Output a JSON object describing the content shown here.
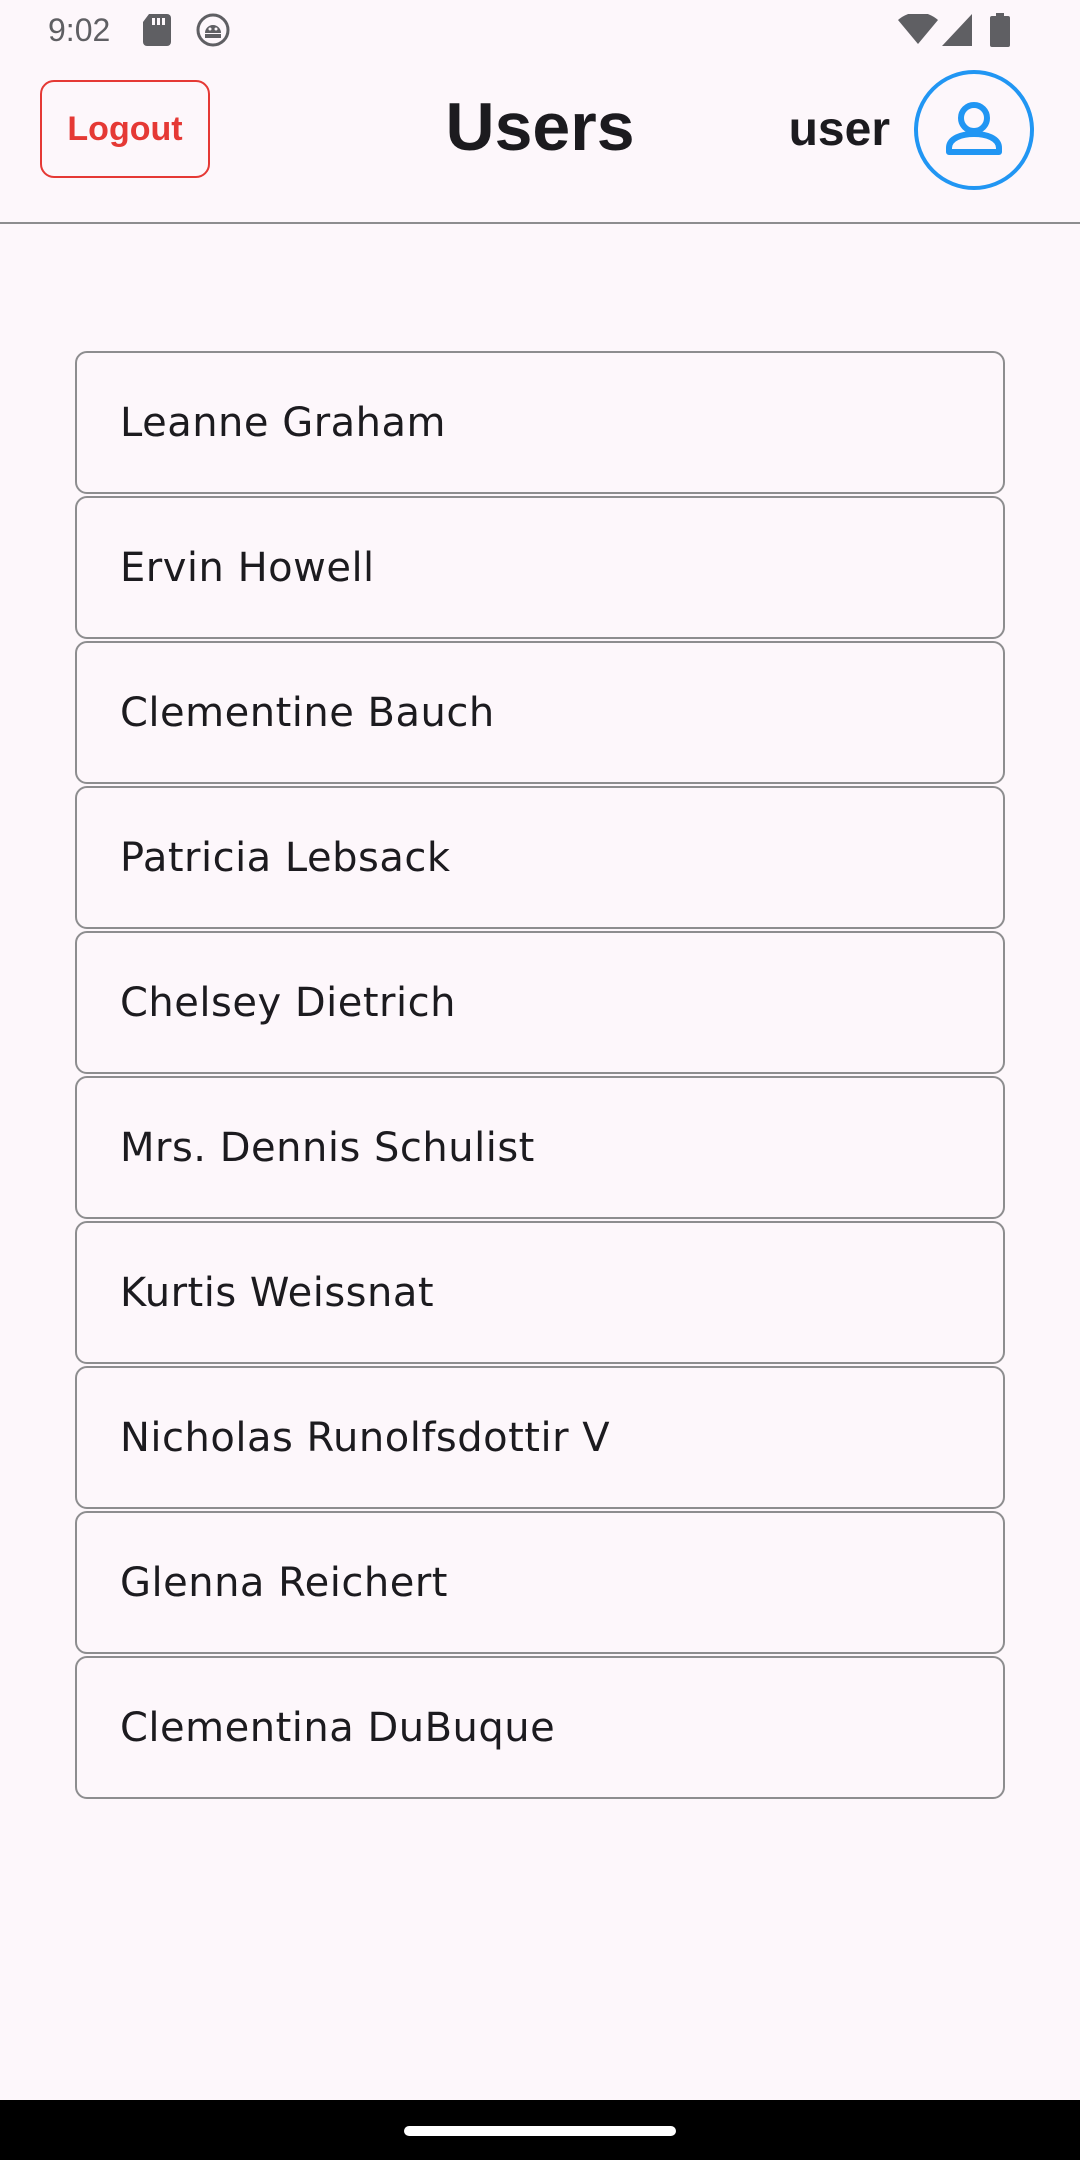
{
  "status_bar": {
    "time": "9:02",
    "icons": [
      "sd-card-icon",
      "android-debug-icon",
      "wifi-icon",
      "signal-icon",
      "battery-icon"
    ]
  },
  "app_bar": {
    "logout_label": "Logout",
    "title": "Users",
    "user_label": "user",
    "avatar_icon": "account-circle-icon"
  },
  "users": [
    "Leanne Graham",
    "Ervin Howell",
    "Clementine Bauch",
    "Patricia Lebsack",
    "Chelsey Dietrich",
    "Mrs. Dennis Schulist",
    "Kurtis Weissnat",
    "Nicholas Runolfsdottir V",
    "Glenna Reichert",
    "Clementina DuBuque"
  ],
  "colors": {
    "background": "#fdf7fb",
    "logout": "#e53935",
    "avatar": "#2196f3",
    "border": "#8d8d8f"
  }
}
